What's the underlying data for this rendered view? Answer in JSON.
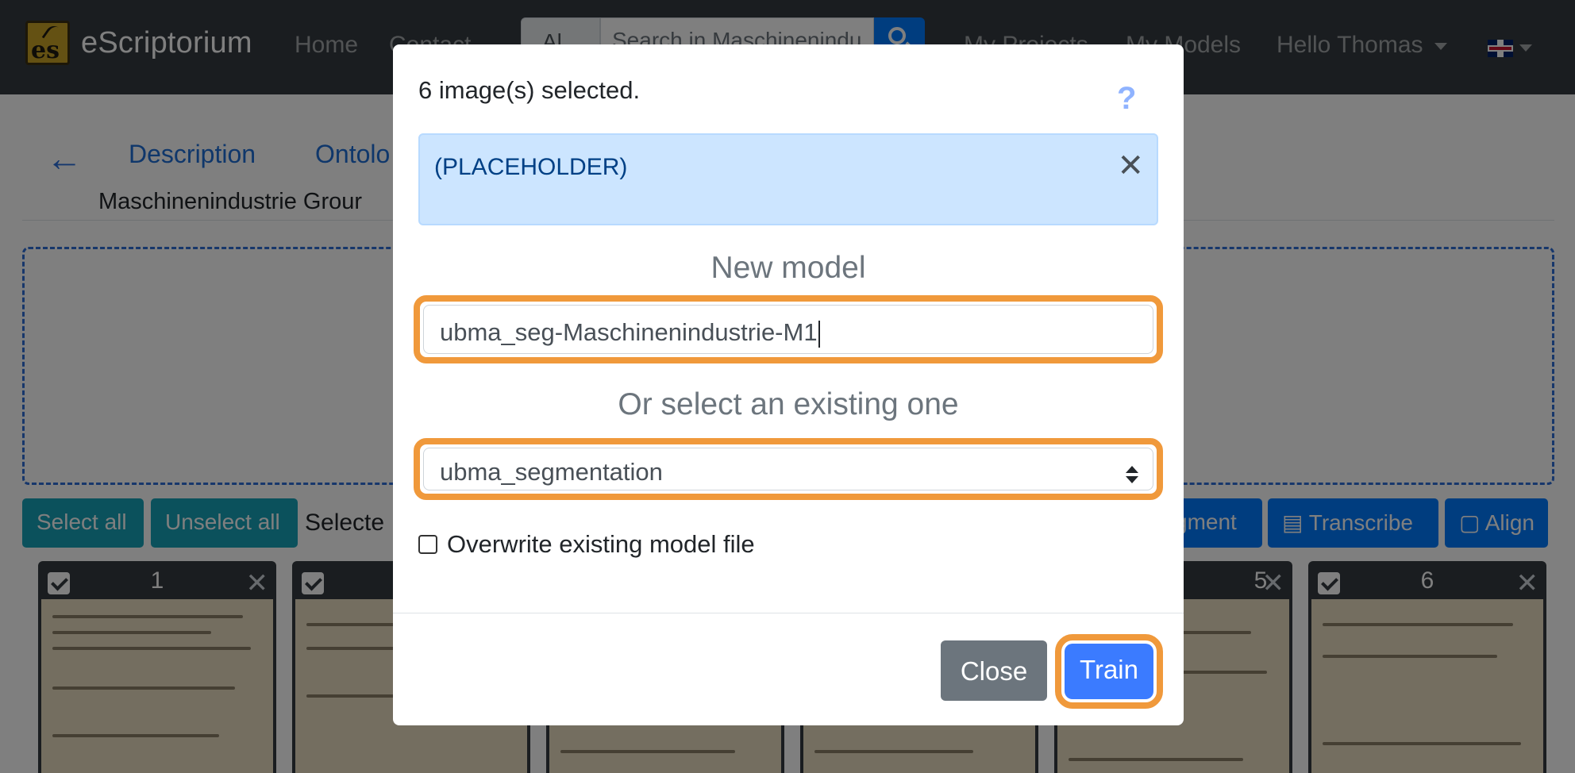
{
  "navbar": {
    "brand": "eScriptorium",
    "logo_text": "es",
    "links": [
      "Home",
      "Contact",
      "My Projects",
      "My Models"
    ],
    "search_scope": "Al",
    "search_placeholder": "Search in Maschinenindu",
    "user_menu": "Hello Thomas",
    "language_icon": "uk-flag-icon"
  },
  "page": {
    "tabs": [
      "Description",
      "Ontolo"
    ],
    "doc_name": "Maschinenindustrie Grour",
    "toolbar": {
      "select_all": "Select all",
      "unselect_all": "Unselect all",
      "selected_label": "Selecte",
      "segment": "gment",
      "transcribe": "Transcribe",
      "align": "Align"
    },
    "cards": [
      {
        "num": "1"
      },
      {
        "num": ""
      },
      {
        "num": ""
      },
      {
        "num": ""
      },
      {
        "num": "5"
      },
      {
        "num": "6"
      }
    ]
  },
  "modal": {
    "count_text": "6 image(s) selected.",
    "help_icon": "?",
    "alert_text": "(PLACEHOLDER)",
    "alert_close": "✕",
    "new_model_heading": "New model",
    "new_model_value": "ubma_seg-Maschinenindustrie-M1",
    "existing_heading": "Or select an existing one",
    "existing_value": "ubma_segmentation",
    "overwrite_label": "Overwrite existing model file",
    "close_button": "Close",
    "train_button": "Train"
  },
  "colors": {
    "navbar": "#343a40",
    "primary": "#007bff",
    "highlight": "#f0993b",
    "alert_bg": "#cce5ff"
  }
}
